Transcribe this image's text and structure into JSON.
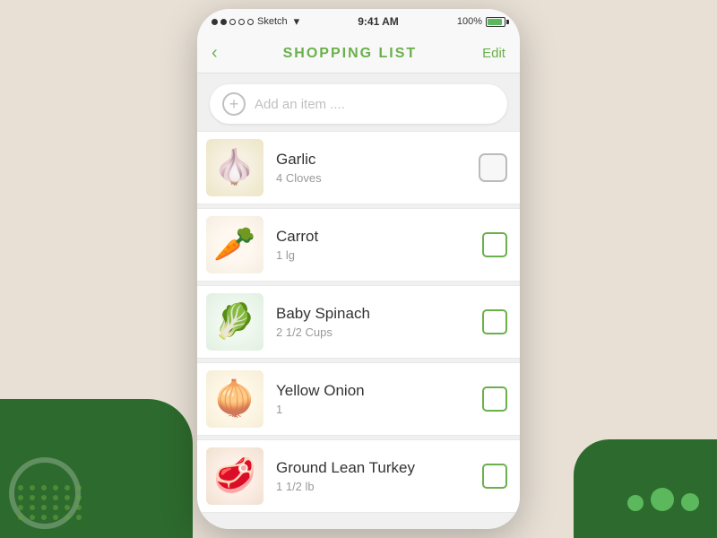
{
  "statusBar": {
    "time": "9:41 AM",
    "battery": "100%",
    "carrier": "Sketch"
  },
  "navBar": {
    "title": "SHOPPING LIST",
    "editLabel": "Edit",
    "backArrow": "‹"
  },
  "addItem": {
    "placeholder": "Add an item ....",
    "plusIcon": "+"
  },
  "items": [
    {
      "id": "garlic",
      "name": "Garlic",
      "quantity": "4 Cloves",
      "emoji": "🧄",
      "checked": false,
      "checkedStyle": "round"
    },
    {
      "id": "carrot",
      "name": "Carrot",
      "quantity": "1 lg",
      "emoji": "🥕",
      "checked": false,
      "checkedStyle": "square"
    },
    {
      "id": "baby-spinach",
      "name": "Baby Spinach",
      "quantity": "2 1/2 Cups",
      "emoji": "🥬",
      "checked": false,
      "checkedStyle": "square"
    },
    {
      "id": "yellow-onion",
      "name": "Yellow Onion",
      "quantity": "1",
      "emoji": "🧅",
      "checked": false,
      "checkedStyle": "square"
    },
    {
      "id": "ground-turkey",
      "name": "Ground Lean Turkey",
      "quantity": "1 1/2 lb",
      "emoji": "🥩",
      "checked": false,
      "checkedStyle": "square"
    }
  ],
  "colors": {
    "green": "#6ab04c",
    "darkGreen": "#2d6a2d"
  }
}
